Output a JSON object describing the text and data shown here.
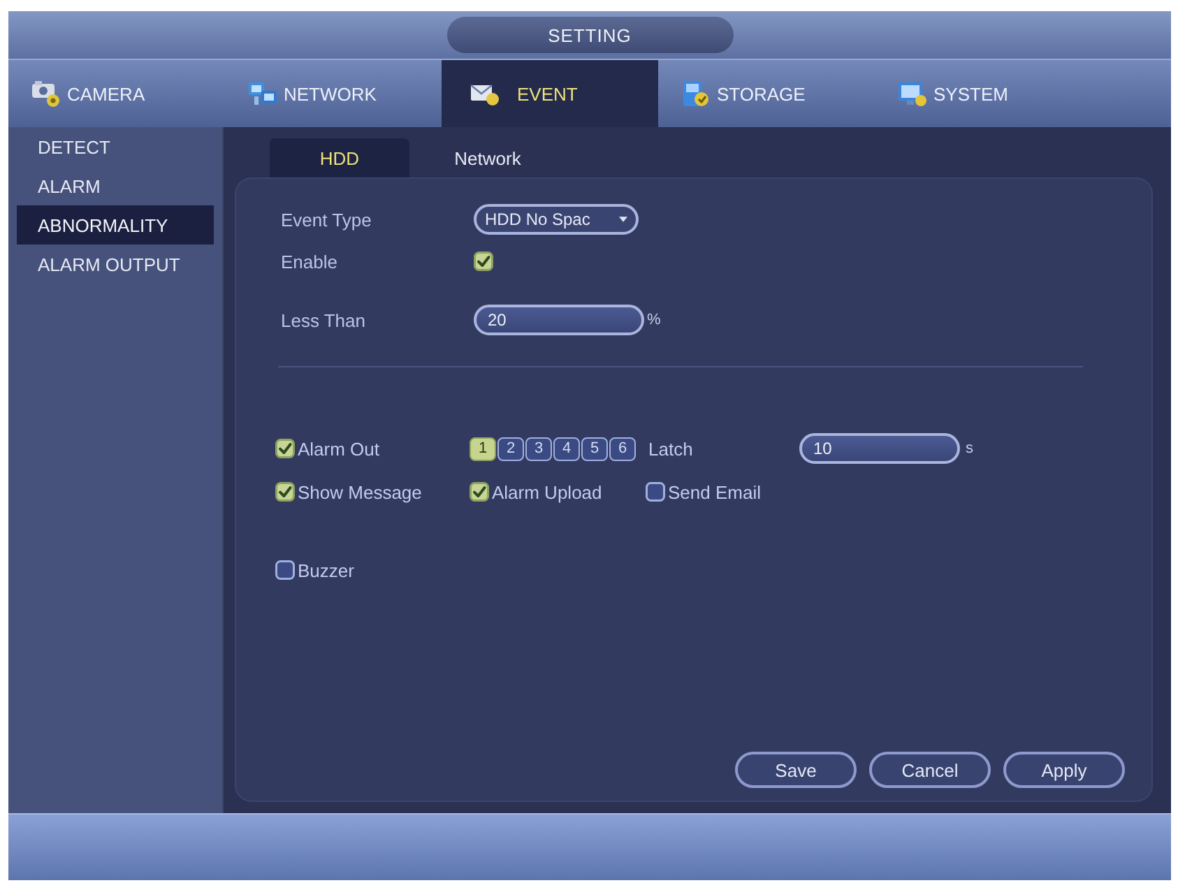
{
  "window": {
    "title": "SETTING"
  },
  "tabs": [
    {
      "label": "CAMERA",
      "selected": false
    },
    {
      "label": "NETWORK",
      "selected": false
    },
    {
      "label": "EVENT",
      "selected": true
    },
    {
      "label": "STORAGE",
      "selected": false
    },
    {
      "label": "SYSTEM",
      "selected": false
    }
  ],
  "sidebar": {
    "items": [
      {
        "label": "DETECT",
        "selected": false
      },
      {
        "label": "ALARM",
        "selected": false
      },
      {
        "label": "ABNORMALITY",
        "selected": true
      },
      {
        "label": "ALARM OUTPUT",
        "selected": false
      }
    ]
  },
  "subtabs": [
    {
      "label": "HDD",
      "selected": true
    },
    {
      "label": "Network",
      "selected": false
    }
  ],
  "form": {
    "event_type": {
      "label": "Event Type",
      "value": "HDD No Spac"
    },
    "enable": {
      "label": "Enable",
      "checked": true
    },
    "less_than": {
      "label": "Less Than",
      "value": "20",
      "unit": "%"
    }
  },
  "alarm_out": {
    "label": "Alarm Out",
    "checked": true,
    "channels": [
      {
        "label": "1",
        "selected": true
      },
      {
        "label": "2",
        "selected": false
      },
      {
        "label": "3",
        "selected": false
      },
      {
        "label": "4",
        "selected": false
      },
      {
        "label": "5",
        "selected": false
      },
      {
        "label": "6",
        "selected": false
      }
    ],
    "latch": {
      "label": "Latch",
      "value": "10",
      "unit": "s"
    }
  },
  "options": [
    {
      "label": "Show Message",
      "checked": true
    },
    {
      "label": "Alarm Upload",
      "checked": true
    },
    {
      "label": "Send Email",
      "checked": false
    }
  ],
  "buzzer": {
    "label": "Buzzer",
    "checked": false
  },
  "buttons": [
    "Save",
    "Cancel",
    "Apply"
  ]
}
